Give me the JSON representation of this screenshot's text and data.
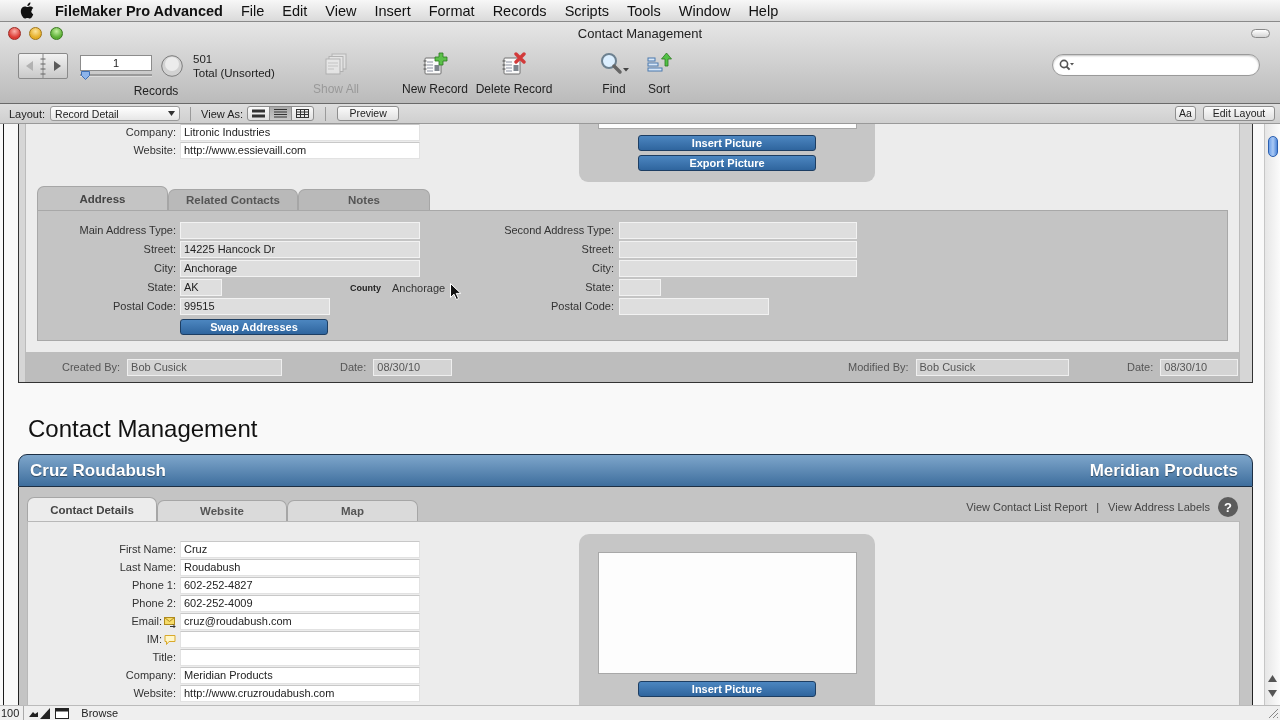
{
  "menu_bar": {
    "app_name": "FileMaker Pro Advanced",
    "menus": [
      "File",
      "Edit",
      "View",
      "Insert",
      "Format",
      "Records",
      "Scripts",
      "Tools",
      "Window",
      "Help"
    ]
  },
  "window": {
    "title": "Contact Management"
  },
  "toolbar": {
    "record_number": "1",
    "record_slider": {
      "level": 0
    },
    "found_count": "501",
    "found_status": "Total (Unsorted)",
    "records_label": "Records",
    "buttons": [
      {
        "kind": "show_all",
        "label": "Show All",
        "disabled": true
      },
      {
        "kind": "new_record",
        "label": "New Record",
        "disabled": false
      },
      {
        "kind": "delete_record",
        "label": "Delete Record",
        "disabled": false
      },
      {
        "kind": "find",
        "label": "Find",
        "disabled": false
      },
      {
        "kind": "sort",
        "label": "Sort",
        "disabled": false
      }
    ]
  },
  "layout_bar": {
    "layout_label": "Layout:",
    "layout": "Record Detail",
    "view_as_label": "View As:",
    "view_modes": [
      {
        "kind": "form",
        "selected": false
      },
      {
        "kind": "list",
        "selected": true
      },
      {
        "kind": "table",
        "selected": false
      }
    ],
    "preview_button": "Preview",
    "text_size_button": "Aa",
    "edit_layout_button": "Edit Layout"
  },
  "first_record": {
    "fields": [
      {
        "label": "Company:",
        "value": "Litronic Industries"
      },
      {
        "label": "Website:",
        "value": "http://www.essievaill.com"
      }
    ],
    "picture_buttons": [
      "Insert Picture",
      "Export Picture"
    ],
    "tabs": [
      {
        "label": "Address",
        "selected": true
      },
      {
        "label": "Related Contacts",
        "selected": false
      },
      {
        "label": "Notes",
        "selected": false
      }
    ],
    "main_address": [
      {
        "label": "Main Address Type:",
        "kind": "long"
      },
      {
        "label": "Street:",
        "value": "14225 Hancock Dr",
        "kind": "long"
      },
      {
        "label": "City:",
        "value": "Anchorage",
        "kind": "long"
      },
      {
        "label": "State:",
        "value": "AK",
        "kind": "state"
      },
      {
        "label": "Postal Code:",
        "value": "99515",
        "kind": "postal"
      }
    ],
    "county": {
      "label": "County",
      "value": "Anchorage"
    },
    "swap_button": "Swap Addresses",
    "second_address": [
      {
        "label": "Second Address Type:",
        "kind": "long"
      },
      {
        "label": "Street:",
        "kind": "long"
      },
      {
        "label": "City:",
        "kind": "long"
      },
      {
        "label": "State:",
        "kind": "state"
      },
      {
        "label": "Postal Code:",
        "kind": "postal"
      }
    ],
    "footer": [
      {
        "label": "Created By:",
        "value": "Bob Cusick"
      },
      {
        "label": "Date:",
        "value": "08/30/10"
      },
      {
        "label": "Modified By:",
        "value": "Bob Cusick"
      },
      {
        "label": "Date:",
        "value": "08/30/10"
      }
    ]
  },
  "list_heading": "Contact Management",
  "second_record": {
    "name": "Cruz Roudabush",
    "company": "Meridian Products",
    "tabs": [
      {
        "label": "Contact Details",
        "selected": true
      },
      {
        "label": "Website",
        "selected": false
      },
      {
        "label": "Map",
        "selected": false
      }
    ],
    "links": [
      "View Contact List Report",
      "View Address Labels"
    ],
    "link_separator": "|",
    "help_button": "?",
    "fields": [
      {
        "label": "First Name:",
        "value": "Cruz",
        "kind": "plain"
      },
      {
        "label": "Last Name:",
        "value": "Roudabush",
        "kind": "plain"
      },
      {
        "label": "Phone 1:",
        "value": "602-252-4827",
        "kind": "plain"
      },
      {
        "label": "Phone 2:",
        "value": "602-252-4009",
        "kind": "plain"
      },
      {
        "label": "Email:",
        "value": "cruz@roudabush.com",
        "kind": "email"
      },
      {
        "label": "IM:",
        "kind": "chat"
      },
      {
        "label": "Title:",
        "kind": "plain"
      },
      {
        "label": "Company:",
        "value": "Meridian Products",
        "kind": "plain"
      },
      {
        "label": "Website:",
        "value": "http://www.cruzroudabush.com",
        "kind": "plain"
      }
    ],
    "picture_buttons": [
      "Insert Picture"
    ]
  },
  "status_bar": {
    "zoom": "100",
    "mode": "Browse"
  }
}
